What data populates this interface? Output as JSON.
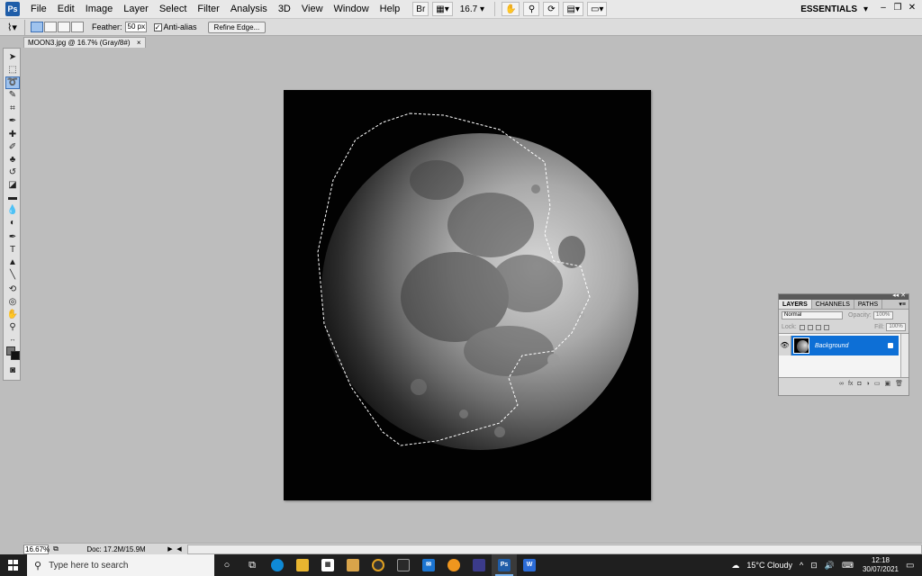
{
  "app": {
    "logo": "Ps"
  },
  "menu": [
    "File",
    "Edit",
    "Image",
    "Layer",
    "Select",
    "Filter",
    "Analysis",
    "3D",
    "View",
    "Window",
    "Help"
  ],
  "menu_tools": {
    "zoom": "16.7"
  },
  "workspace_switcher": "ESSENTIALS",
  "options": {
    "feather_label": "Feather:",
    "feather_value": "50 px",
    "antialias_label": "Anti-alias",
    "antialias_checked": true,
    "refine_edge_label": "Refine Edge..."
  },
  "document": {
    "tab_title": "MOON3.jpg @ 16.7% (Gray/8#)"
  },
  "status": {
    "zoom": "16.67%",
    "doc_info": "Doc: 17.2M/15.9M"
  },
  "layers_panel": {
    "tabs": [
      "LAYERS",
      "CHANNELS",
      "PATHS"
    ],
    "blend_mode": "Normal",
    "opacity_label": "Opacity:",
    "opacity_value": "100%",
    "lock_label": "Lock:",
    "fill_label": "Fill:",
    "fill_value": "100%",
    "layers": [
      {
        "name": "Background",
        "visible": true,
        "locked": true
      }
    ]
  },
  "taskbar": {
    "search_placeholder": "Type here to search",
    "weather": "15°C  Cloudy",
    "time": "12:18",
    "date": "30/07/2021"
  },
  "colors": {
    "accent": "#0d6fd6",
    "taskbar_bg": "#1f1f1f"
  }
}
